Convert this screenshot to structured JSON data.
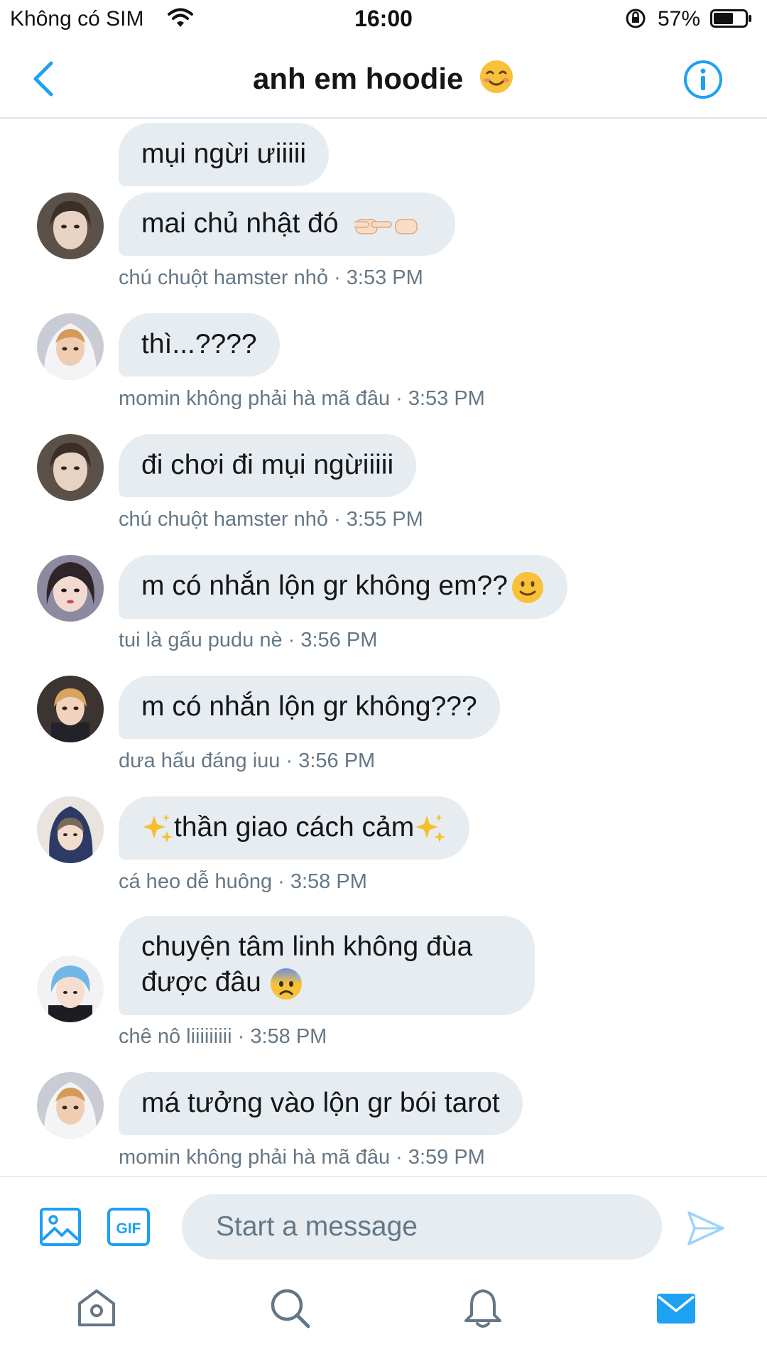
{
  "status_bar": {
    "carrier": "Không có SIM",
    "time": "16:00",
    "battery": "57%",
    "icons": [
      "wifi-icon",
      "orientation-lock-icon",
      "battery-icon"
    ]
  },
  "header": {
    "title": "anh em hoodie",
    "title_emoji": "smiling-face-emoji",
    "back_icon": "chevron-left-icon",
    "info_icon": "info-icon"
  },
  "messages": [
    {
      "text": "mụi ngừi ưiiiii",
      "meta": "",
      "avatar": false
    },
    {
      "text": "mai chủ nhật đó",
      "emoji": "pointing-fingers-emoji",
      "meta": "chú chuột hamster nhỏ · 3:53 PM",
      "avatar": true
    },
    {
      "text": "thì...????",
      "meta": "momin không phải hà mã đâu · 3:53 PM",
      "avatar": true
    },
    {
      "text": "đi chơi đi mụi ngừiiiii",
      "meta": "chú chuột hamster nhỏ · 3:55 PM",
      "avatar": true
    },
    {
      "text": "m có nhắn lộn gr không em??",
      "emoji": "slightly-smiling-emoji",
      "meta": "tui là gấu pudu nè · 3:56 PM",
      "avatar": true
    },
    {
      "text": "m có nhắn lộn gr không???",
      "meta": "dưa hấu đáng iuu · 3:56 PM",
      "avatar": true
    },
    {
      "text": "thần giao cách cảm",
      "emoji": "sparkles-emoji",
      "meta": "cá heo dễ huông · 3:58 PM",
      "avatar": true
    },
    {
      "text": "chuyện tâm linh không đùa được đâu",
      "emoji": "anxious-sweat-emoji",
      "meta": "chê nô liiiiiiiii · 3:58 PM",
      "avatar": true
    },
    {
      "text": "má tưởng vào lộn gr bói tarot",
      "meta": "momin không phải hà mã đâu · 3:59 PM",
      "avatar": true
    }
  ],
  "composer": {
    "placeholder": "Start a message",
    "media_icon": "image-icon",
    "gif_label": "GIF",
    "send_icon": "send-icon"
  },
  "tab_bar": {
    "tabs": [
      "home-icon",
      "search-icon",
      "notifications-icon",
      "messages-icon"
    ],
    "active": "messages-icon"
  },
  "colors": {
    "accent": "#1da1f2",
    "bubble": "#e6ecf0",
    "meta_text": "#657786",
    "divider": "#dfe3e7"
  }
}
